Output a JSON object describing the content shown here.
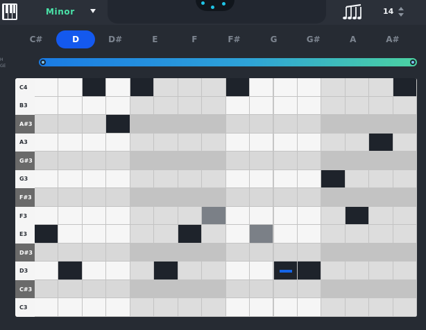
{
  "header": {
    "scale_label": "Minor",
    "note_count": "14"
  },
  "icons": {
    "piano": "piano-keys-icon",
    "dropdown": "chevron-down-icon",
    "notes": "music-notes-icon",
    "stepper": "stepper-arrows-icon"
  },
  "root_keys": {
    "items": [
      "C#",
      "D",
      "D#",
      "E",
      "F",
      "F#",
      "G",
      "G#",
      "A",
      "A#"
    ],
    "selected": "D"
  },
  "range": {
    "label_line1": "H",
    "label_line2": "GE"
  },
  "grid": {
    "rows": [
      {
        "label": "C4",
        "black": false
      },
      {
        "label": "B3",
        "black": false
      },
      {
        "label": "A#3",
        "black": true
      },
      {
        "label": "A3",
        "black": false
      },
      {
        "label": "G#3",
        "black": true
      },
      {
        "label": "G3",
        "black": false
      },
      {
        "label": "F#3",
        "black": true
      },
      {
        "label": "F3",
        "black": false
      },
      {
        "label": "E3",
        "black": false
      },
      {
        "label": "D#3",
        "black": true
      },
      {
        "label": "D3",
        "black": false
      },
      {
        "label": "C#3",
        "black": true
      },
      {
        "label": "C3",
        "black": false
      }
    ],
    "columns": 16,
    "active_cells": [
      [
        0,
        2
      ],
      [
        0,
        4
      ],
      [
        0,
        8
      ],
      [
        0,
        15
      ],
      [
        2,
        3
      ],
      [
        3,
        14
      ],
      [
        5,
        12
      ],
      [
        7,
        13
      ],
      [
        8,
        0
      ],
      [
        8,
        6
      ],
      [
        10,
        1
      ],
      [
        10,
        5
      ],
      [
        10,
        10
      ],
      [
        10,
        11
      ]
    ],
    "ghost_cells": [
      [
        7,
        7
      ],
      [
        8,
        9
      ]
    ],
    "playhead": {
      "row": 10,
      "column": 10.5
    }
  },
  "colors": {
    "accent_blue": "#1459ee",
    "scale_green": "#4ae3a8",
    "range_start": "#1a7be4",
    "range_end": "#4bd2a2"
  }
}
